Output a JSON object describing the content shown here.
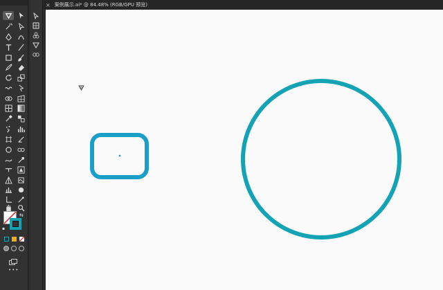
{
  "tab": {
    "close_glyph": "×",
    "title": "案例展示.ai* @ 84.48% (RGB/GPU 预览)"
  },
  "toolbar": {
    "more_label": "•••"
  },
  "colors": {
    "accent": "#13a3b5",
    "rounded_rect_stroke": "#1a9fc9",
    "anchor_point": "#1a8fd6"
  },
  "icons": [
    "shaper-icon",
    "selection-icon",
    "magic-wand-icon",
    "direct-selection-icon",
    "pen-icon",
    "curvature-icon",
    "type-icon",
    "line-icon",
    "rectangle-icon",
    "paintbrush-icon",
    "shaper-pencil-icon",
    "eraser-icon",
    "rotate-icon",
    "scale-icon",
    "warp-icon",
    "free-transform-icon",
    "shape-builder-icon",
    "perspective-icon",
    "mesh-icon",
    "gradient-icon",
    "eyedropper-icon",
    "blend-icon",
    "symbol-sprayer-icon",
    "column-graph-icon",
    "artboard-icon",
    "slice-icon",
    "hand-icon",
    "zoom-icon"
  ]
}
